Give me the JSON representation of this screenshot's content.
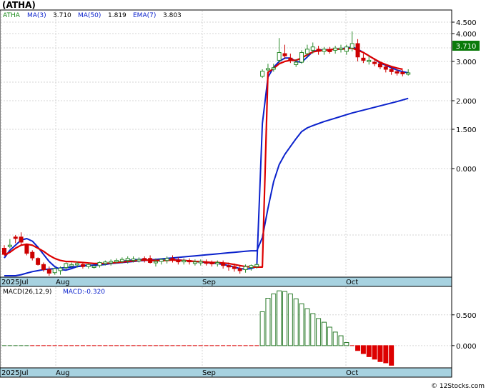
{
  "ticker_title": "(ATHA)",
  "legend": {
    "symbol": "ATHA",
    "ma3_label": "MA(3)",
    "ma3_value": "3.710",
    "ma50_label": "MA(50)",
    "ma50_value": "1.819",
    "ema7_label": "EMA(7)",
    "ema7_value": "3.803"
  },
  "macd_legend": {
    "params": "MACD(26,12,9)",
    "value_label": "MACD:-0.320"
  },
  "price_badge": "3.710",
  "watermark": "© 12Stocks.com",
  "colors": {
    "ma_blue": "#0b22cc",
    "ema_red": "#dd0000",
    "up_candle": "#2a8a2a",
    "down_candle": "#cc0000",
    "axis_band": "#a7d2e0",
    "badge_green": "#0a7a0a",
    "macd_pos": "#2a7a2a",
    "macd_neg": "#dd0000"
  },
  "chart_data": [
    {
      "type": "candlestick",
      "scale": "custom-compressed",
      "x_tick_labels": [
        "2025Jul",
        "Aug",
        "Sep",
        "Oct"
      ],
      "y_tick_labels": [
        "4.500",
        "4.000",
        "3.000",
        "2.000",
        "1.500",
        "0.000"
      ],
      "ylim": [
        0.2,
        4.9
      ],
      "candles": [
        [
          0.74,
          0.8,
          0.62,
          0.6
        ],
        [
          0.78,
          0.92,
          0.8,
          0.74
        ],
        [
          0.96,
          1.0,
          0.94,
          0.84
        ],
        [
          0.96,
          1.02,
          0.86,
          0.8
        ],
        [
          0.8,
          0.82,
          0.64,
          0.6
        ],
        [
          0.66,
          0.7,
          0.55,
          0.5
        ],
        [
          0.54,
          0.56,
          0.42,
          0.4
        ],
        [
          0.42,
          0.46,
          0.32,
          0.28
        ],
        [
          0.32,
          0.38,
          0.25,
          0.2
        ],
        [
          0.26,
          0.36,
          0.34,
          0.22
        ],
        [
          0.3,
          0.38,
          0.35,
          0.22
        ],
        [
          0.36,
          0.46,
          0.44,
          0.32
        ],
        [
          0.4,
          0.46,
          0.42,
          0.36
        ],
        [
          0.42,
          0.48,
          0.44,
          0.36
        ],
        [
          0.42,
          0.46,
          0.38,
          0.34
        ],
        [
          0.38,
          0.44,
          0.42,
          0.34
        ],
        [
          0.38,
          0.42,
          0.39,
          0.34
        ],
        [
          0.4,
          0.48,
          0.46,
          0.36
        ],
        [
          0.44,
          0.5,
          0.47,
          0.4
        ],
        [
          0.46,
          0.52,
          0.48,
          0.4
        ],
        [
          0.48,
          0.54,
          0.5,
          0.44
        ],
        [
          0.48,
          0.56,
          0.52,
          0.44
        ],
        [
          0.5,
          0.58,
          0.54,
          0.44
        ],
        [
          0.52,
          0.58,
          0.53,
          0.46
        ],
        [
          0.52,
          0.56,
          0.52,
          0.46
        ],
        [
          0.54,
          0.58,
          0.52,
          0.46
        ],
        [
          0.54,
          0.6,
          0.46,
          0.44
        ],
        [
          0.46,
          0.54,
          0.48,
          0.38
        ],
        [
          0.48,
          0.54,
          0.52,
          0.42
        ],
        [
          0.5,
          0.58,
          0.54,
          0.44
        ],
        [
          0.54,
          0.6,
          0.52,
          0.46
        ],
        [
          0.5,
          0.56,
          0.48,
          0.42
        ],
        [
          0.48,
          0.54,
          0.5,
          0.42
        ],
        [
          0.5,
          0.54,
          0.48,
          0.42
        ],
        [
          0.46,
          0.52,
          0.47,
          0.4
        ],
        [
          0.46,
          0.52,
          0.48,
          0.4
        ],
        [
          0.47,
          0.52,
          0.46,
          0.4
        ],
        [
          0.46,
          0.5,
          0.44,
          0.38
        ],
        [
          0.44,
          0.5,
          0.46,
          0.38
        ],
        [
          0.44,
          0.5,
          0.4,
          0.34
        ],
        [
          0.4,
          0.46,
          0.38,
          0.3
        ],
        [
          0.38,
          0.44,
          0.34,
          0.28
        ],
        [
          0.34,
          0.4,
          0.3,
          0.24
        ],
        [
          0.32,
          0.42,
          0.38,
          0.26
        ],
        [
          0.36,
          0.42,
          0.4,
          0.3
        ],
        [
          0.38,
          0.44,
          0.42,
          0.34
        ],
        [
          3.62,
          3.8,
          3.75,
          3.58
        ],
        [
          3.8,
          3.94,
          3.82,
          3.74
        ],
        [
          3.8,
          3.94,
          3.84,
          3.74
        ],
        [
          4.02,
          4.42,
          4.16,
          3.96
        ],
        [
          4.14,
          4.3,
          4.1,
          4.04
        ],
        [
          4.06,
          4.14,
          4.02,
          3.96
        ],
        [
          3.92,
          4.04,
          3.98,
          3.86
        ],
        [
          3.98,
          4.2,
          4.16,
          3.94
        ],
        [
          4.14,
          4.3,
          4.22,
          4.08
        ],
        [
          4.2,
          4.34,
          4.26,
          4.14
        ],
        [
          4.22,
          4.28,
          4.18,
          4.12
        ],
        [
          4.18,
          4.26,
          4.22,
          4.12
        ],
        [
          4.2,
          4.26,
          4.18,
          4.14
        ],
        [
          4.2,
          4.28,
          4.24,
          4.14
        ],
        [
          4.22,
          4.3,
          4.24,
          4.16
        ],
        [
          4.18,
          4.3,
          4.26,
          4.12
        ],
        [
          4.24,
          4.56,
          4.32,
          4.18
        ],
        [
          4.32,
          4.4,
          4.08,
          4.0
        ],
        [
          4.06,
          4.14,
          4.02,
          3.96
        ],
        [
          4.0,
          4.1,
          4.02,
          3.92
        ],
        [
          3.98,
          4.06,
          3.96,
          3.88
        ],
        [
          3.94,
          4.0,
          3.86,
          3.8
        ],
        [
          3.86,
          3.92,
          3.8,
          3.72
        ],
        [
          3.8,
          3.86,
          3.74,
          3.66
        ],
        [
          3.74,
          3.8,
          3.72,
          3.64
        ],
        [
          3.72,
          3.78,
          3.7,
          3.62
        ],
        [
          3.7,
          3.8,
          3.71,
          3.64
        ]
      ],
      "ma3_series": [
        0.55,
        0.7,
        0.8,
        0.9,
        0.93,
        0.88,
        0.76,
        0.62,
        0.48,
        0.38,
        0.32,
        0.31,
        0.34,
        0.38,
        0.4,
        0.41,
        0.4,
        0.41,
        0.42,
        0.44,
        0.46,
        0.48,
        0.5,
        0.51,
        0.52,
        0.52,
        0.5,
        0.49,
        0.5,
        0.51,
        0.52,
        0.51,
        0.5,
        0.49,
        0.48,
        0.47,
        0.46,
        0.45,
        0.44,
        0.42,
        0.4,
        0.37,
        0.34,
        0.33,
        0.34,
        0.38,
        2.2,
        3.6,
        3.85,
        4.0,
        4.06,
        4.06,
        4.0,
        3.98,
        4.08,
        4.18,
        4.2,
        4.21,
        4.21,
        4.22,
        4.23,
        4.24,
        4.26,
        4.22,
        4.16,
        4.1,
        4.04,
        3.96,
        3.9,
        3.84,
        3.78,
        3.74,
        3.71
      ],
      "ema7_series": [
        0.6,
        0.66,
        0.74,
        0.8,
        0.82,
        0.8,
        0.74,
        0.68,
        0.6,
        0.54,
        0.5,
        0.48,
        0.48,
        0.47,
        0.46,
        0.45,
        0.44,
        0.44,
        0.44,
        0.45,
        0.46,
        0.47,
        0.48,
        0.49,
        0.5,
        0.51,
        0.5,
        0.5,
        0.5,
        0.5,
        0.51,
        0.5,
        0.5,
        0.49,
        0.48,
        0.48,
        0.47,
        0.46,
        0.46,
        0.45,
        0.44,
        0.42,
        0.4,
        0.38,
        0.37,
        0.37,
        0.37,
        3.72,
        3.82,
        3.94,
        4.0,
        4.02,
        4.02,
        4.06,
        4.12,
        4.17,
        4.19,
        4.2,
        4.21,
        4.22,
        4.22,
        4.23,
        4.24,
        4.2,
        4.16,
        4.1,
        4.04,
        3.98,
        3.92,
        3.87,
        3.83,
        3.8
      ],
      "ma50_series": [
        0.05,
        0.12,
        0.18,
        0.22,
        0.25,
        0.28,
        0.3,
        0.32,
        0.33,
        0.34,
        0.35,
        0.36,
        0.37,
        0.38,
        0.39,
        0.4,
        0.41,
        0.42,
        0.43,
        0.44,
        0.45,
        0.46,
        0.47,
        0.48,
        0.49,
        0.5,
        0.51,
        0.52,
        0.53,
        0.54,
        0.55,
        0.56,
        0.57,
        0.58,
        0.59,
        0.6,
        0.61,
        0.62,
        0.63,
        0.64,
        0.65,
        0.66,
        0.67,
        0.68,
        0.69,
        0.69,
        0.95,
        1.2,
        1.4,
        1.55,
        1.68,
        1.78,
        1.88,
        1.97,
        2.05,
        2.13,
        2.2,
        2.27,
        2.33,
        2.39,
        2.45,
        2.51,
        2.57,
        2.62,
        2.67,
        2.72,
        2.77,
        2.82,
        2.87,
        2.92,
        2.97,
        3.02,
        3.06
      ]
    },
    {
      "type": "bar",
      "title": "MACD(26,12,9)",
      "y_tick_labels": [
        "0.500",
        "0.000"
      ],
      "ylim": [
        -0.35,
        0.95
      ],
      "values": [
        0.01,
        0.01,
        0.01,
        0.01,
        0.0,
        -0.01,
        -0.01,
        -0.02,
        -0.02,
        -0.02,
        -0.02,
        -0.01,
        -0.01,
        -0.01,
        -0.01,
        -0.01,
        -0.01,
        -0.01,
        -0.01,
        -0.01,
        -0.01,
        -0.01,
        -0.01,
        -0.01,
        -0.01,
        -0.01,
        -0.01,
        -0.01,
        -0.01,
        -0.01,
        -0.01,
        -0.01,
        -0.01,
        -0.01,
        -0.01,
        -0.01,
        -0.01,
        -0.01,
        -0.01,
        -0.01,
        -0.01,
        -0.01,
        -0.01,
        -0.01,
        -0.01,
        -0.01,
        0.55,
        0.77,
        0.84,
        0.89,
        0.88,
        0.84,
        0.76,
        0.68,
        0.6,
        0.52,
        0.44,
        0.38,
        0.3,
        0.22,
        0.16,
        0.05,
        -0.02,
        -0.08,
        -0.13,
        -0.18,
        -0.22,
        -0.26,
        -0.28,
        -0.32
      ]
    }
  ]
}
